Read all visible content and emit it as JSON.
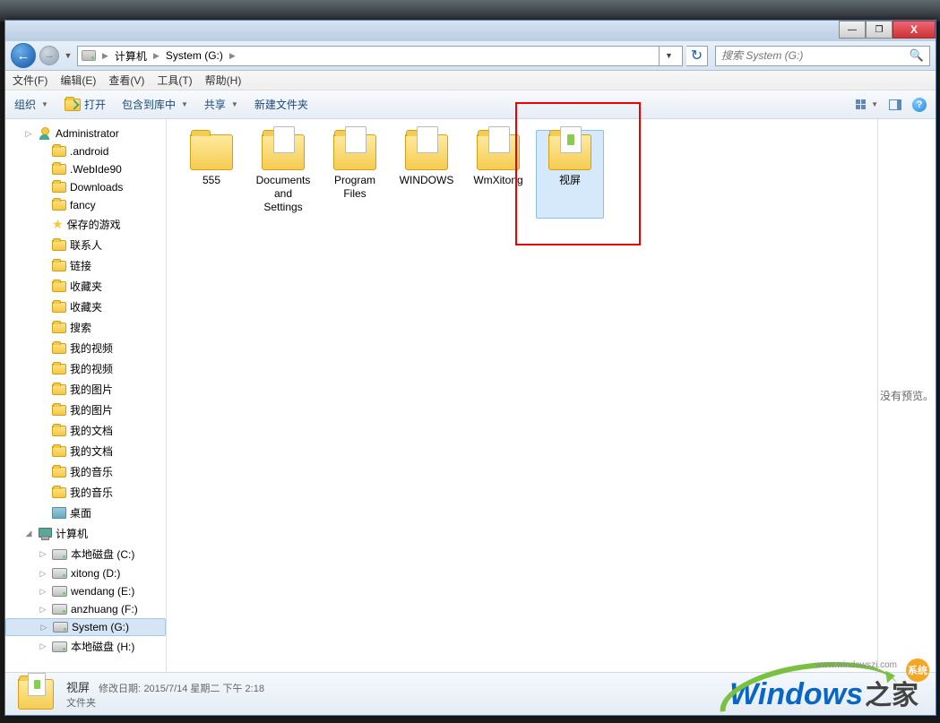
{
  "titlebar": {
    "close": "X",
    "min": "—",
    "max": "❐"
  },
  "nav": {
    "crumbs": [
      "计算机",
      "System (G:)"
    ],
    "search_placeholder": "搜索 System (G:)"
  },
  "menubar": [
    "文件(F)",
    "编辑(E)",
    "查看(V)",
    "工具(T)",
    "帮助(H)"
  ],
  "toolbar": {
    "organize": "组织",
    "open": "打开",
    "include": "包含到库中",
    "share": "共享",
    "newfolder": "新建文件夹"
  },
  "tree": [
    {
      "icon": "user",
      "label": "Administrator",
      "indent": 1,
      "exp": "▷"
    },
    {
      "icon": "folder",
      "label": ".android",
      "indent": 2
    },
    {
      "icon": "folder",
      "label": ".WebIde90",
      "indent": 2
    },
    {
      "icon": "folder",
      "label": "Downloads",
      "indent": 2
    },
    {
      "icon": "folder",
      "label": "fancy",
      "indent": 2
    },
    {
      "icon": "star",
      "label": "保存的游戏",
      "indent": 2
    },
    {
      "icon": "folder",
      "label": "联系人",
      "indent": 2
    },
    {
      "icon": "folder",
      "label": "链接",
      "indent": 2
    },
    {
      "icon": "folder",
      "label": "收藏夹",
      "indent": 2
    },
    {
      "icon": "folder",
      "label": "收藏夹",
      "indent": 2
    },
    {
      "icon": "folder",
      "label": "搜索",
      "indent": 2
    },
    {
      "icon": "folder",
      "label": "我的视频",
      "indent": 2
    },
    {
      "icon": "folder",
      "label": "我的视频",
      "indent": 2
    },
    {
      "icon": "folder",
      "label": "我的图片",
      "indent": 2
    },
    {
      "icon": "folder",
      "label": "我的图片",
      "indent": 2
    },
    {
      "icon": "folder",
      "label": "我的文档",
      "indent": 2
    },
    {
      "icon": "folder",
      "label": "我的文档",
      "indent": 2
    },
    {
      "icon": "folder",
      "label": "我的音乐",
      "indent": 2
    },
    {
      "icon": "folder",
      "label": "我的音乐",
      "indent": 2
    },
    {
      "icon": "desk",
      "label": "桌面",
      "indent": 2
    },
    {
      "icon": "pc",
      "label": "计算机",
      "indent": 1,
      "exp": "◢"
    },
    {
      "icon": "drive",
      "label": "本地磁盘 (C:)",
      "indent": 2,
      "exp": "▷"
    },
    {
      "icon": "drive",
      "label": "xitong (D:)",
      "indent": 2,
      "exp": "▷"
    },
    {
      "icon": "drive",
      "label": "wendang (E:)",
      "indent": 2,
      "exp": "▷"
    },
    {
      "icon": "drive",
      "label": "anzhuang (F:)",
      "indent": 2,
      "exp": "▷"
    },
    {
      "icon": "drive",
      "label": "System (G:)",
      "indent": 2,
      "exp": "▷",
      "selected": true
    },
    {
      "icon": "drive",
      "label": "本地磁盘 (H:)",
      "indent": 2,
      "exp": "▷"
    }
  ],
  "items": [
    {
      "label": "555",
      "type": "folder"
    },
    {
      "label": "Documents and Settings",
      "type": "folder-paper"
    },
    {
      "label": "Program Files",
      "type": "folder-paper"
    },
    {
      "label": "WINDOWS",
      "type": "folder-paper"
    },
    {
      "label": "WmXitong",
      "type": "folder-paper"
    },
    {
      "label": "视屏",
      "type": "folder-sel",
      "selected": true
    }
  ],
  "preview": {
    "empty": "没有预览。"
  },
  "status": {
    "name": "视屏",
    "type": "文件夹",
    "meta_label": "修改日期:",
    "meta_value": "2015/7/14 星期二 下午 2:18"
  },
  "watermark": {
    "brand": "Windows",
    "zh": "之家",
    "url": "www.windowszj.com",
    "badge": "系统"
  }
}
